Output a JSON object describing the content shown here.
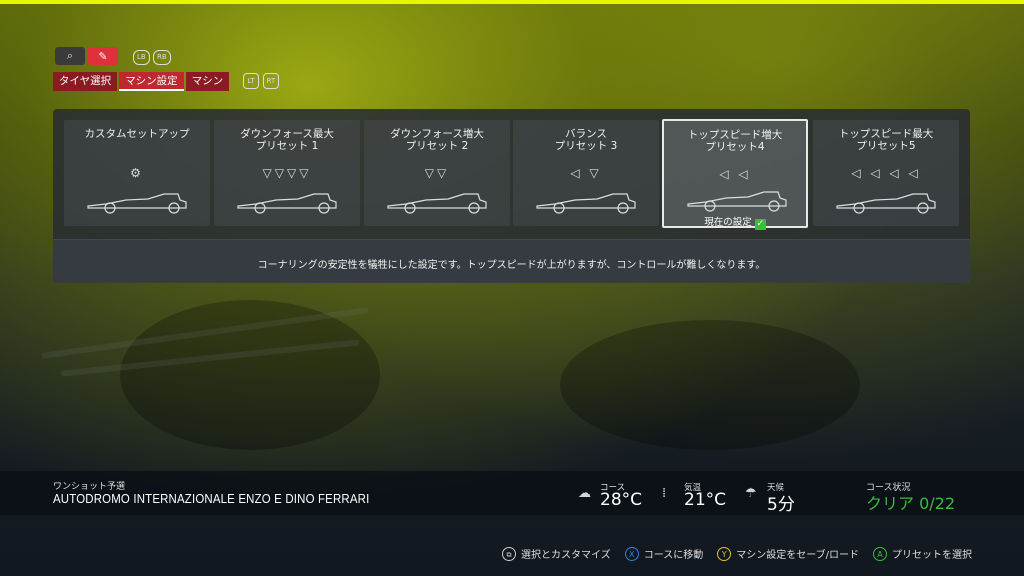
{
  "top_tabs": [
    "タイヤ選択",
    "マシン設定",
    "マシン"
  ],
  "active_tab": 1,
  "bumpers": {
    "left": "LB",
    "right": "RB"
  },
  "triggers": {
    "left": "LT",
    "right": "RT"
  },
  "presets": [
    {
      "title": "カスタムセットアップ",
      "icons": "⚙",
      "current": false
    },
    {
      "title": "ダウンフォース最大\nプリセット 1",
      "icons": "▽▽▽▽",
      "current": false
    },
    {
      "title": "ダウンフォース増大\nプリセット 2",
      "icons": "▽▽",
      "current": false
    },
    {
      "title": "バランス\nプリセット 3",
      "icons": "◁ ▽",
      "current": false
    },
    {
      "title": "トップスピード増大\nプリセット4",
      "icons": "◁ ◁",
      "current": true
    },
    {
      "title": "トップスピード最大\nプリセット5",
      "icons": "◁ ◁ ◁ ◁",
      "current": false
    }
  ],
  "current_setting_label": "現在の設定",
  "description": "コーナリングの安定性を犠牲にした設定です。トップスピードが上がりますが、コントロールが難しくなります。",
  "session": {
    "mode": "ワンショット予選",
    "track": "AUTODROMO INTERNAZIONALE ENZO E DINO FERRARI"
  },
  "weather": {
    "track_temp": {
      "label": "コース",
      "value": "28°C",
      "icon": "cloud-icon"
    },
    "air_temp": {
      "label": "気温",
      "value": "21°C",
      "icon": "air-icon"
    },
    "forecast": {
      "label": "天候",
      "value": "5分",
      "icon": "rain-cloud-icon"
    }
  },
  "track_status": {
    "label": "コース状況",
    "value": "クリア 0/22"
  },
  "hints": [
    {
      "button": "⧉",
      "label": "選択とカスタマイズ"
    },
    {
      "button": "X",
      "label": "コースに移動"
    },
    {
      "button": "Y",
      "label": "マシン設定をセーブ/ロード"
    },
    {
      "button": "A",
      "label": "プリセットを選択"
    }
  ],
  "colors": {
    "accent_red": "#c0272f",
    "accent_green": "#3dbb3d",
    "top_line": "#e6f500"
  }
}
